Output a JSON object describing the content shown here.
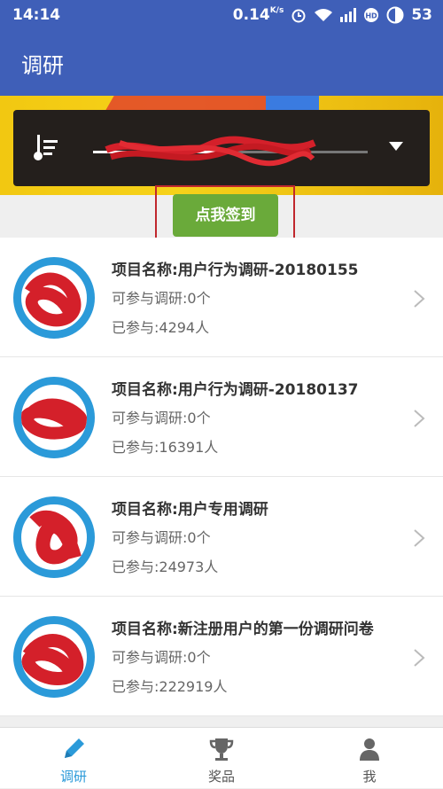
{
  "status": {
    "time": "14:14",
    "speed": "0.14",
    "speed_unit": "K/s",
    "battery": "53"
  },
  "app": {
    "title": "调研"
  },
  "banner": {
    "sign_in_label": "点我签到"
  },
  "surveys": [
    {
      "name": "项目名称:用户行为调研-20180155",
      "available": "可参与调研:0个",
      "joined": "已参与:4294人"
    },
    {
      "name": "项目名称:用户行为调研-20180137",
      "available": "可参与调研:0个",
      "joined": "已参与:16391人"
    },
    {
      "name": "项目名称:用户专用调研",
      "available": "可参与调研:0个",
      "joined": "已参与:24973人"
    },
    {
      "name": "项目名称:新注册用户的第一份调研问卷",
      "available": "可参与调研:0个",
      "joined": "已参与:222919人"
    }
  ],
  "tabs": [
    {
      "label": "调研"
    },
    {
      "label": "奖品"
    },
    {
      "label": "我"
    }
  ],
  "colors": {
    "primary": "#3f5fb8",
    "accent": "#2b9ad9",
    "sign_button": "#6aaa3a"
  }
}
